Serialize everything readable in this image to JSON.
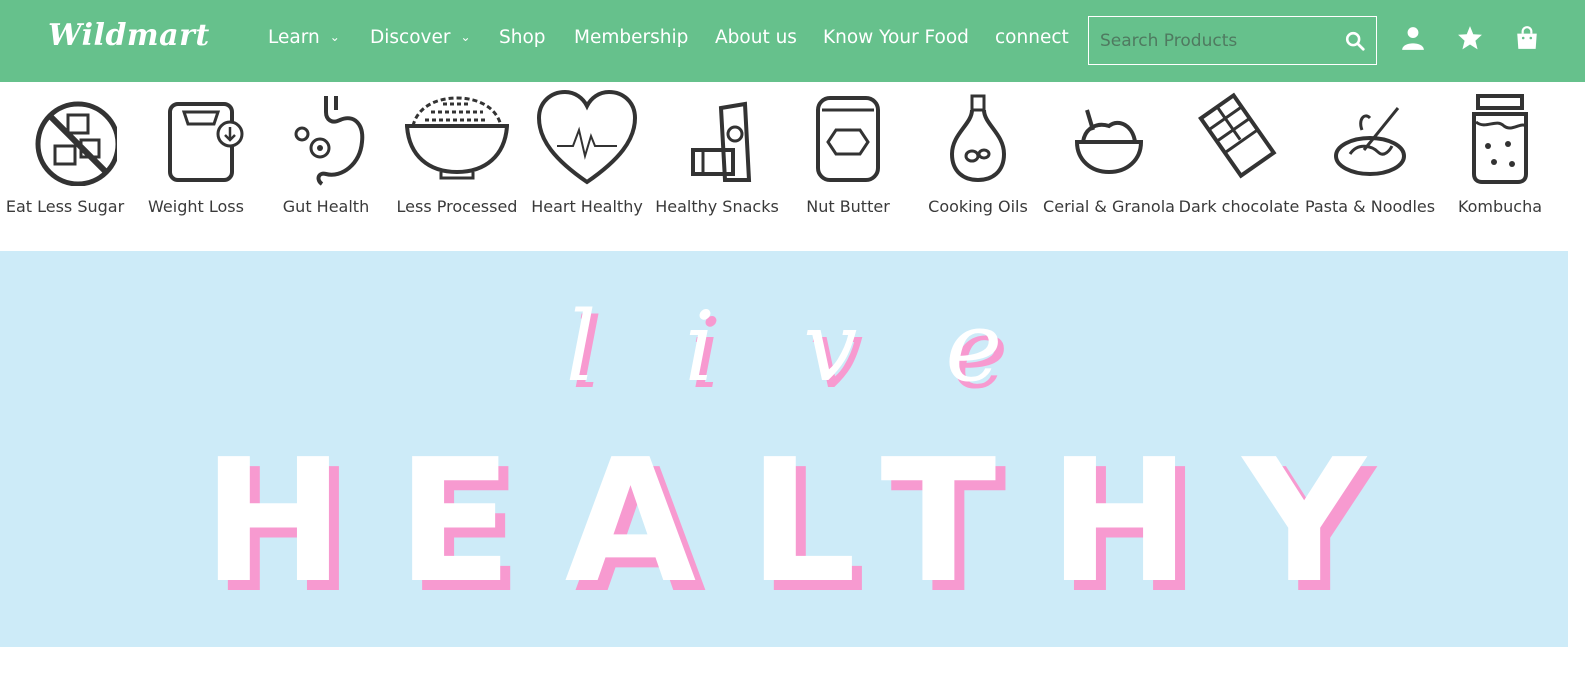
{
  "header": {
    "logo": "Wildmart",
    "nav": [
      {
        "label": "Learn",
        "has_dropdown": true
      },
      {
        "label": "Discover",
        "has_dropdown": true
      },
      {
        "label": "Shop",
        "has_dropdown": false
      },
      {
        "label": "Membership",
        "has_dropdown": false
      },
      {
        "label": "About us",
        "has_dropdown": false
      },
      {
        "label": "Know Your Food",
        "has_dropdown": false
      },
      {
        "label": "connect",
        "has_dropdown": false
      }
    ],
    "search": {
      "placeholder": "Search Products",
      "value": ""
    },
    "icons": [
      "user-icon",
      "star-icon",
      "shopping-bag-icon"
    ],
    "colors": {
      "header_bg": "#66c18c",
      "text": "#ffffff"
    }
  },
  "categories": [
    {
      "label": "Eat Less Sugar",
      "icon": "no-sugar-icon"
    },
    {
      "label": "Weight Loss",
      "icon": "scale-icon"
    },
    {
      "label": "Gut Health",
      "icon": "stomach-icon"
    },
    {
      "label": "Less Processed",
      "icon": "grain-bowl-icon"
    },
    {
      "label": "Heart Healthy",
      "icon": "heart-icon"
    },
    {
      "label": "Healthy Snacks",
      "icon": "snack-bar-icon"
    },
    {
      "label": "Nut Butter",
      "icon": "jar-icon"
    },
    {
      "label": "Cooking Oils",
      "icon": "oil-bottle-icon"
    },
    {
      "label": "Cerial & Granola",
      "icon": "cereal-bowl-icon"
    },
    {
      "label": "Dark chocolate",
      "icon": "chocolate-icon"
    },
    {
      "label": "Pasta & Noodles",
      "icon": "pasta-icon"
    },
    {
      "label": "Kombucha",
      "icon": "kombucha-jar-icon"
    }
  ],
  "hero": {
    "line1": "live",
    "line2": "HEALTHY",
    "colors": {
      "bg": "#cdebf8",
      "text": "#ffffff",
      "shadow": "#f79ad0"
    }
  }
}
